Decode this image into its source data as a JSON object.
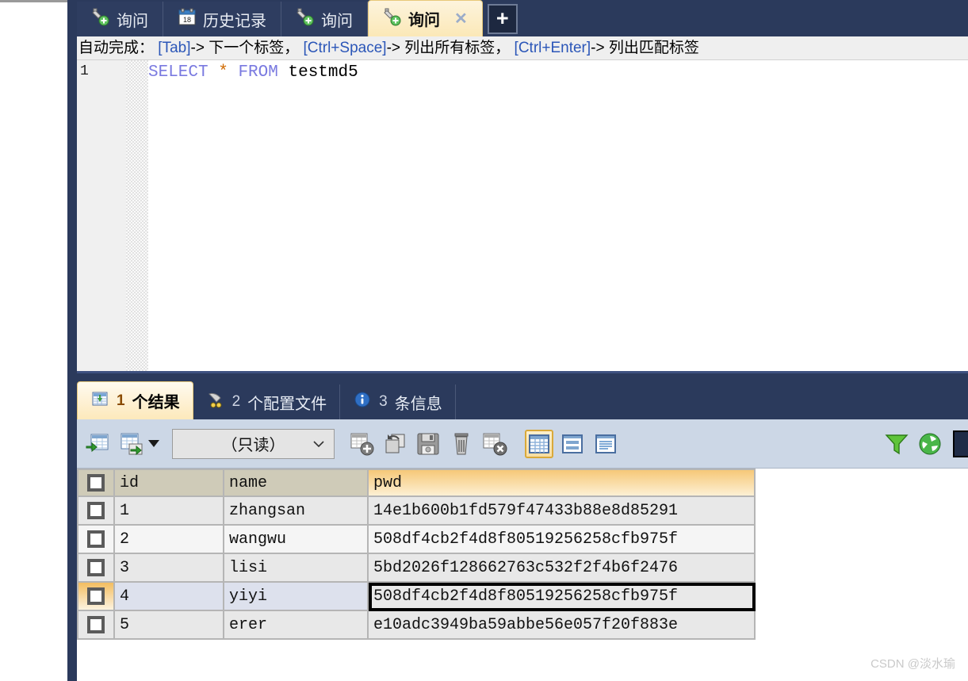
{
  "window": {
    "tabs": [
      {
        "label": "询问",
        "icon": "query-plug-icon",
        "active": false,
        "closable": false
      },
      {
        "label": "历史记录",
        "icon": "calendar-icon",
        "active": false,
        "closable": false
      },
      {
        "label": "询问",
        "icon": "query-plug-icon",
        "active": false,
        "closable": false
      },
      {
        "label": "询问",
        "icon": "query-plug-icon",
        "active": true,
        "closable": true
      }
    ],
    "new_tab_label": "+",
    "close_label": "✕"
  },
  "hint": {
    "prefix": "自动完成：",
    "key1": "[Tab]",
    "text1": "-> 下一个标签，",
    "key2": "[Ctrl+Space]",
    "text2": "-> 列出所有标签，",
    "key3": "[Ctrl+Enter]",
    "text3": "-> 列出匹配标签"
  },
  "editor": {
    "line_number": "1",
    "sql_keyword1": "SELECT",
    "sql_star": "*",
    "sql_keyword2": "FROM",
    "sql_table": "testmd5"
  },
  "result_tabs": [
    {
      "num": "1",
      "label": "个结果",
      "icon": "result-grid-icon",
      "active": true
    },
    {
      "num": "2",
      "label": "个配置文件",
      "icon": "profile-icon",
      "active": false
    },
    {
      "num": "3",
      "label": "条信息",
      "icon": "info-icon",
      "active": false
    }
  ],
  "toolbar": {
    "import_wizard": "import-wizard-icon",
    "export_wizard": "export-wizard-icon",
    "export_dropdown": "chevron-down-icon",
    "mode_value": "（只读）",
    "add_record": "add-record-icon",
    "copy_record": "duplicate-record-icon",
    "save_record": "save-icon",
    "delete_record": "delete-record-icon",
    "cancel_record": "cancel-record-icon",
    "view_grid": "grid-view-icon",
    "view_form": "form-view-icon",
    "view_text": "text-view-icon",
    "filter": "filter-icon",
    "refresh": "refresh-icon"
  },
  "grid": {
    "columns": [
      "id",
      "name",
      "pwd"
    ],
    "highlighted_column": "pwd",
    "rows": [
      {
        "id": "1",
        "name": "zhangsan",
        "pwd": "14e1b600b1fd579f47433b88e8d85291"
      },
      {
        "id": "2",
        "name": "wangwu",
        "pwd": "508df4cb2f4d8f80519256258cfb975f"
      },
      {
        "id": "3",
        "name": "lisi",
        "pwd": "5bd2026f128662763c532f2f4b6f2476"
      },
      {
        "id": "4",
        "name": "yiyi",
        "pwd": "508df4cb2f4d8f80519256258cfb975f"
      },
      {
        "id": "5",
        "name": "erer",
        "pwd": "e10adc3949ba59abbe56e057f20f883e"
      }
    ],
    "selected_row_index": 3,
    "focused_cell": "pwd"
  },
  "watermark": "CSDN @淡水瑜",
  "colors": {
    "chrome_dark": "#2b3a5c",
    "tab_active": "#fde9bb",
    "accent_orange": "#d9a93a",
    "toolbar_bg": "#ccd7e6",
    "header_bg": "#cfcbb8",
    "selection_blue": "#dde1ed"
  }
}
